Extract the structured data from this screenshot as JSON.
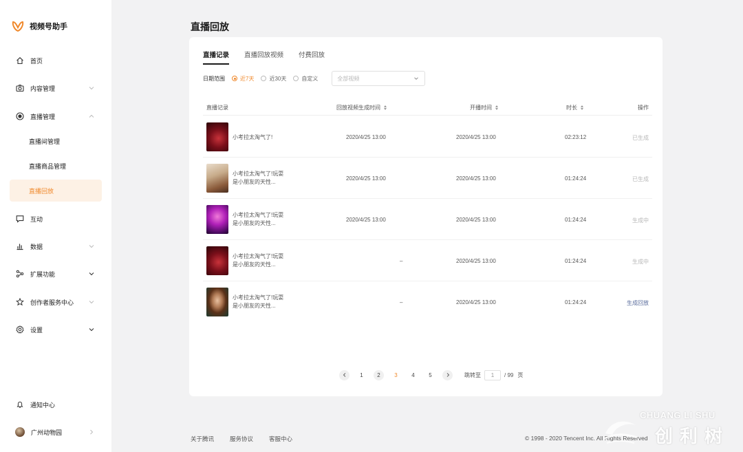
{
  "brand": {
    "name": "视频号助手",
    "logo_color": "#f0892c"
  },
  "sidebar": {
    "items": [
      {
        "label": "首页",
        "icon": "home-icon"
      },
      {
        "label": "内容管理",
        "icon": "camera-icon",
        "chevron": "down"
      },
      {
        "label": "直播管理",
        "icon": "live-icon",
        "chevron": "up"
      },
      {
        "label": "直播间管理"
      },
      {
        "label": "直播商品管理"
      },
      {
        "label": "直播回放",
        "active": true
      },
      {
        "label": "互动",
        "icon": "chat-icon"
      },
      {
        "label": "数据",
        "icon": "bar-chart-icon",
        "chevron": "down"
      },
      {
        "label": "扩展功能",
        "icon": "extension-icon",
        "chevron": "down"
      },
      {
        "label": "创作者服务中心",
        "icon": "star-icon",
        "chevron": "down"
      },
      {
        "label": "设置",
        "icon": "gear-icon",
        "chevron": "down"
      }
    ],
    "notifications": "通知中心",
    "account": "广州动物园"
  },
  "page_title": "直播回放",
  "tabs": [
    {
      "label": "直播记录",
      "active": true
    },
    {
      "label": "直播回放视频"
    },
    {
      "label": "付费回放"
    }
  ],
  "filters": {
    "date_label": "日期范围",
    "options": [
      "近7天",
      "近30天",
      "自定义"
    ],
    "selected": "近7天",
    "select_placeholder": "全部视频"
  },
  "table": {
    "headers": [
      "直播记录",
      "回放视频生成时间",
      "开播时间",
      "时长",
      "操作"
    ],
    "rows": [
      {
        "title": "小考拉太淘气了!",
        "replay_time": "2020/4/25 13:00",
        "start_time": "2020/4/25 13:00",
        "duration": "02:23:12",
        "action": "已生成",
        "thumb": "thumb-red-stage"
      },
      {
        "title": "小考拉太淘气了!玩耍是小朋友的天性...",
        "replay_time": "2020/4/25 13:00",
        "start_time": "2020/4/25 13:00",
        "duration": "01:24:24",
        "action": "已生成",
        "thumb": "thumb-guitar"
      },
      {
        "title": "小考拉太淘气了!玩耍是小朋友的天性...",
        "replay_time": "2020/4/25 13:00",
        "start_time": "2020/4/25 13:00",
        "duration": "01:24:24",
        "action": "生成中",
        "thumb": "thumb-purple-stage"
      },
      {
        "title": "小考拉太淘气了!玩耍是小朋友的天性...",
        "replay_time": "–",
        "start_time": "2020/4/25 13:00",
        "duration": "01:24:24",
        "action": "生成中",
        "thumb": "thumb-red-stage"
      },
      {
        "title": "小考拉太淘气了!玩耍是小朋友的天性...",
        "replay_time": "–",
        "start_time": "2020/4/25 13:00",
        "duration": "01:24:24",
        "action": "生成回放",
        "thumb": "thumb-portrait"
      }
    ]
  },
  "pagination": {
    "pages": [
      "1",
      "2",
      "3",
      "4",
      "5"
    ],
    "current": "3",
    "jump_label": "跳转至",
    "jump_value": "1",
    "total": "/ 99",
    "unit": "页"
  },
  "footer": {
    "links": [
      "关于腾讯",
      "服务协议",
      "客服中心"
    ],
    "copyright": "© 1998 - 2020 Tencent Inc. All Rights Reserved"
  },
  "watermark": {
    "top": "CHUANG LI SHU",
    "bottom": "创利树"
  },
  "colors": {
    "accent": "#f0892c",
    "link": "#5a6c9c",
    "muted": "#b8b8b8",
    "active_bg": "#fdf1e5"
  }
}
